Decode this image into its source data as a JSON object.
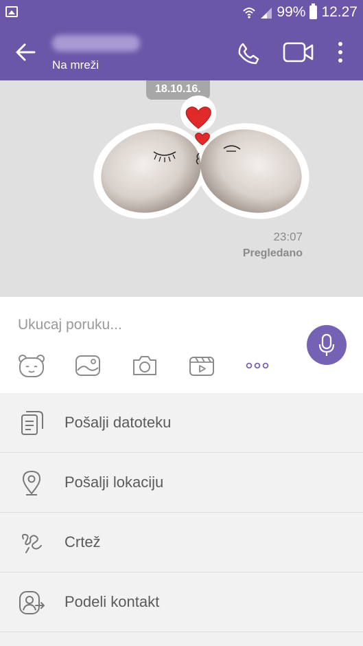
{
  "status_bar": {
    "battery": "99%",
    "time": "12.27"
  },
  "header": {
    "presence": "Na mreži"
  },
  "chat": {
    "date_badge": "18.10.16.",
    "message": {
      "time": "23:07",
      "status": "Pregledano"
    }
  },
  "composer": {
    "placeholder": "Ukucaj poruku..."
  },
  "attach_menu": {
    "items": [
      {
        "label": "Pošalji datoteku",
        "icon": "file-icon"
      },
      {
        "label": "Pošalji lokaciju",
        "icon": "location-pin-icon"
      },
      {
        "label": "Crtež",
        "icon": "doodle-icon"
      },
      {
        "label": "Podeli kontakt",
        "icon": "share-contact-icon"
      }
    ]
  },
  "colors": {
    "brand": "#6a57a8",
    "accent": "#7562b5",
    "chat_background": "#e0e0e0"
  }
}
